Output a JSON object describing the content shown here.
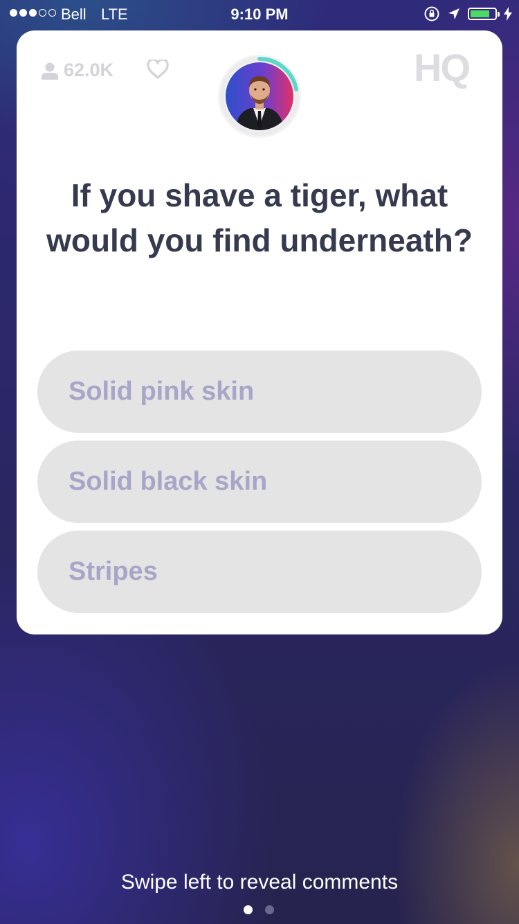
{
  "status_bar": {
    "carrier": "Bell",
    "network": "LTE",
    "time": "9:10 PM",
    "signal_bars_filled": 3,
    "signal_bars_total": 5,
    "battery_level_percent": 80,
    "battery_color": "#4cd964",
    "icons": [
      "orientation-lock-icon",
      "location-arrow-icon",
      "battery-icon",
      "charging-bolt-icon"
    ]
  },
  "header": {
    "viewer_count": "62.0K",
    "viewer_icon": "user-icon",
    "heart_icon": "heart-icon",
    "logo": "HQ",
    "timer_progress": 0.22,
    "timer_color": "#5fd7c8"
  },
  "question": {
    "text": "If you shave a tiger, what would you find underneath?"
  },
  "answers": [
    {
      "label": "Solid pink skin"
    },
    {
      "label": "Solid black skin"
    },
    {
      "label": "Stripes"
    }
  ],
  "footer": {
    "hint": "Swipe left to reveal comments",
    "page_index": 1,
    "page_count": 2
  },
  "colors": {
    "question_text": "#363a4e",
    "answer_text": "#a8a6c8",
    "answer_bg": "#e4e4e4"
  }
}
